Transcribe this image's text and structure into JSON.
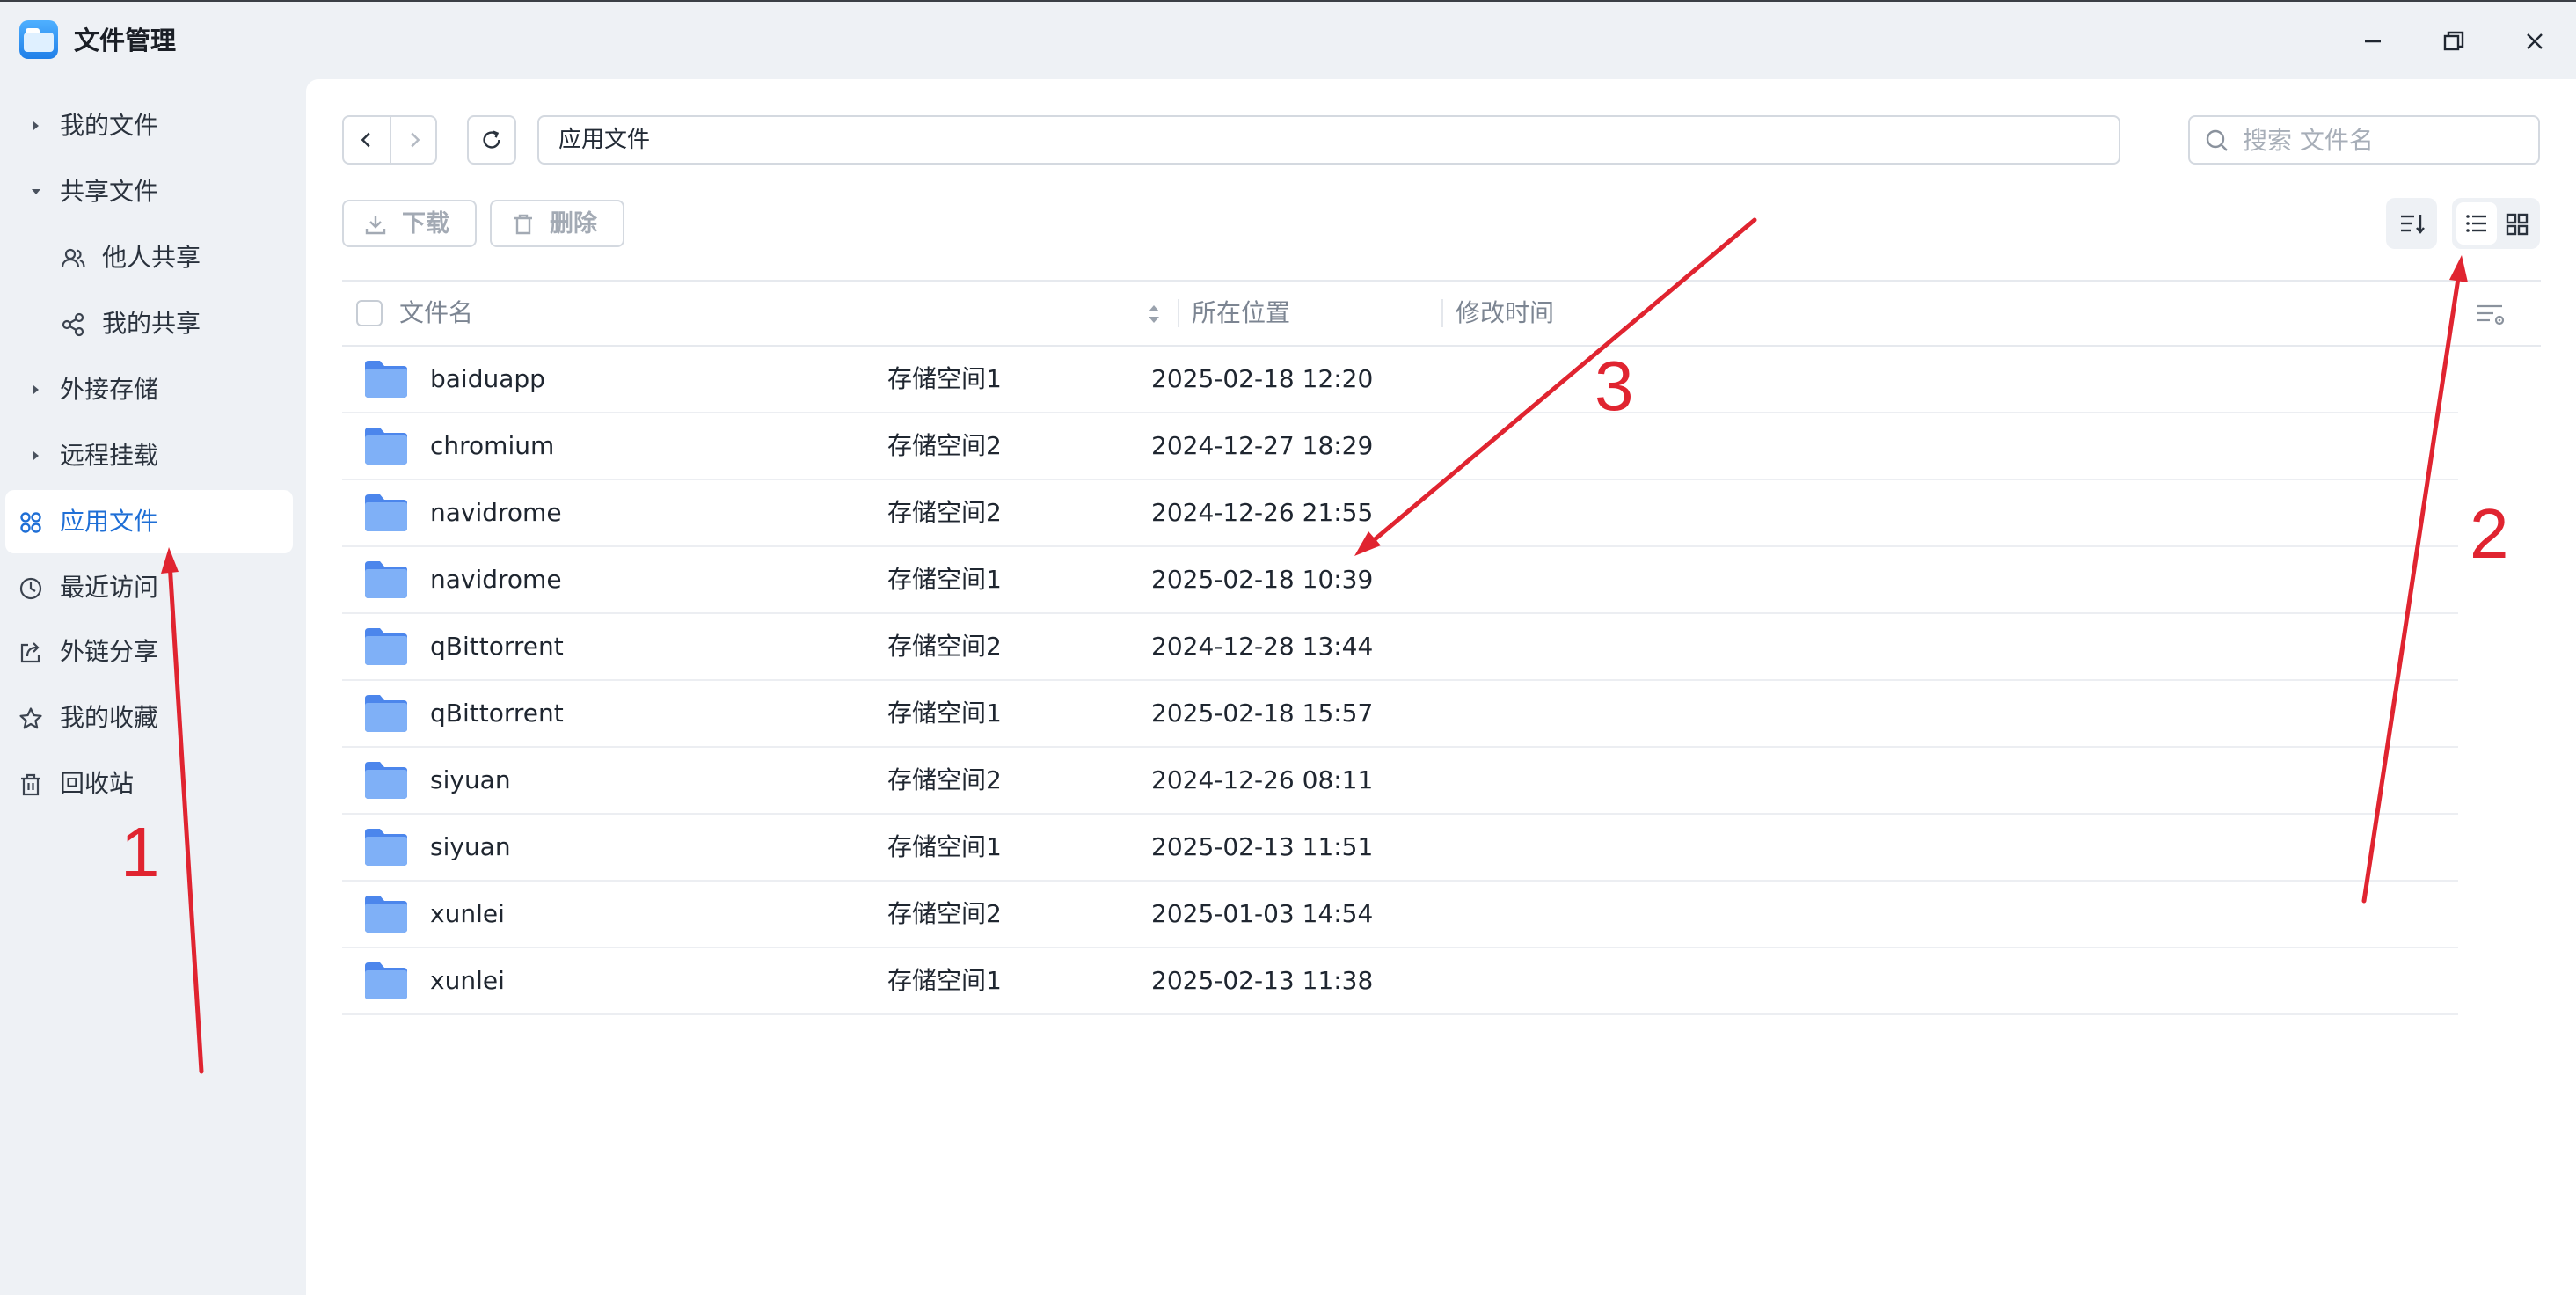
{
  "app": {
    "title": "文件管理"
  },
  "sidebar": {
    "items": [
      {
        "label": "我的文件"
      },
      {
        "label": "共享文件"
      },
      {
        "label": "他人共享"
      },
      {
        "label": "我的共享"
      },
      {
        "label": "外接存储"
      },
      {
        "label": "远程挂载"
      },
      {
        "label": "应用文件"
      },
      {
        "label": "最近访问"
      },
      {
        "label": "外链分享"
      },
      {
        "label": "我的收藏"
      },
      {
        "label": "回收站"
      }
    ]
  },
  "toolbar": {
    "path": "应用文件",
    "search_placeholder": "搜索 文件名",
    "download_label": "下载",
    "delete_label": "删除"
  },
  "table": {
    "headers": {
      "name": "文件名",
      "location": "所在位置",
      "modified": "修改时间"
    },
    "rows": [
      {
        "name": "baiduapp",
        "location": "存储空间1",
        "modified": "2025-02-18 12:20"
      },
      {
        "name": "chromium",
        "location": "存储空间2",
        "modified": "2024-12-27 18:29"
      },
      {
        "name": "navidrome",
        "location": "存储空间2",
        "modified": "2024-12-26 21:55"
      },
      {
        "name": "navidrome",
        "location": "存储空间1",
        "modified": "2025-02-18 10:39"
      },
      {
        "name": "qBittorrent",
        "location": "存储空间2",
        "modified": "2024-12-28 13:44"
      },
      {
        "name": "qBittorrent",
        "location": "存储空间1",
        "modified": "2025-02-18 15:57"
      },
      {
        "name": "siyuan",
        "location": "存储空间2",
        "modified": "2024-12-26 08:11"
      },
      {
        "name": "siyuan",
        "location": "存储空间1",
        "modified": "2025-02-13 11:51"
      },
      {
        "name": "xunlei",
        "location": "存储空间2",
        "modified": "2025-01-03 14:54"
      },
      {
        "name": "xunlei",
        "location": "存储空间1",
        "modified": "2025-02-13 11:38"
      }
    ]
  },
  "annotations": {
    "one": "1",
    "two": "2",
    "three": "3",
    "color": "#e02430"
  },
  "colors": {
    "accent": "#1f6fd6",
    "folder": "#6fa3f5",
    "sidebar_bg": "#eef1f5"
  }
}
